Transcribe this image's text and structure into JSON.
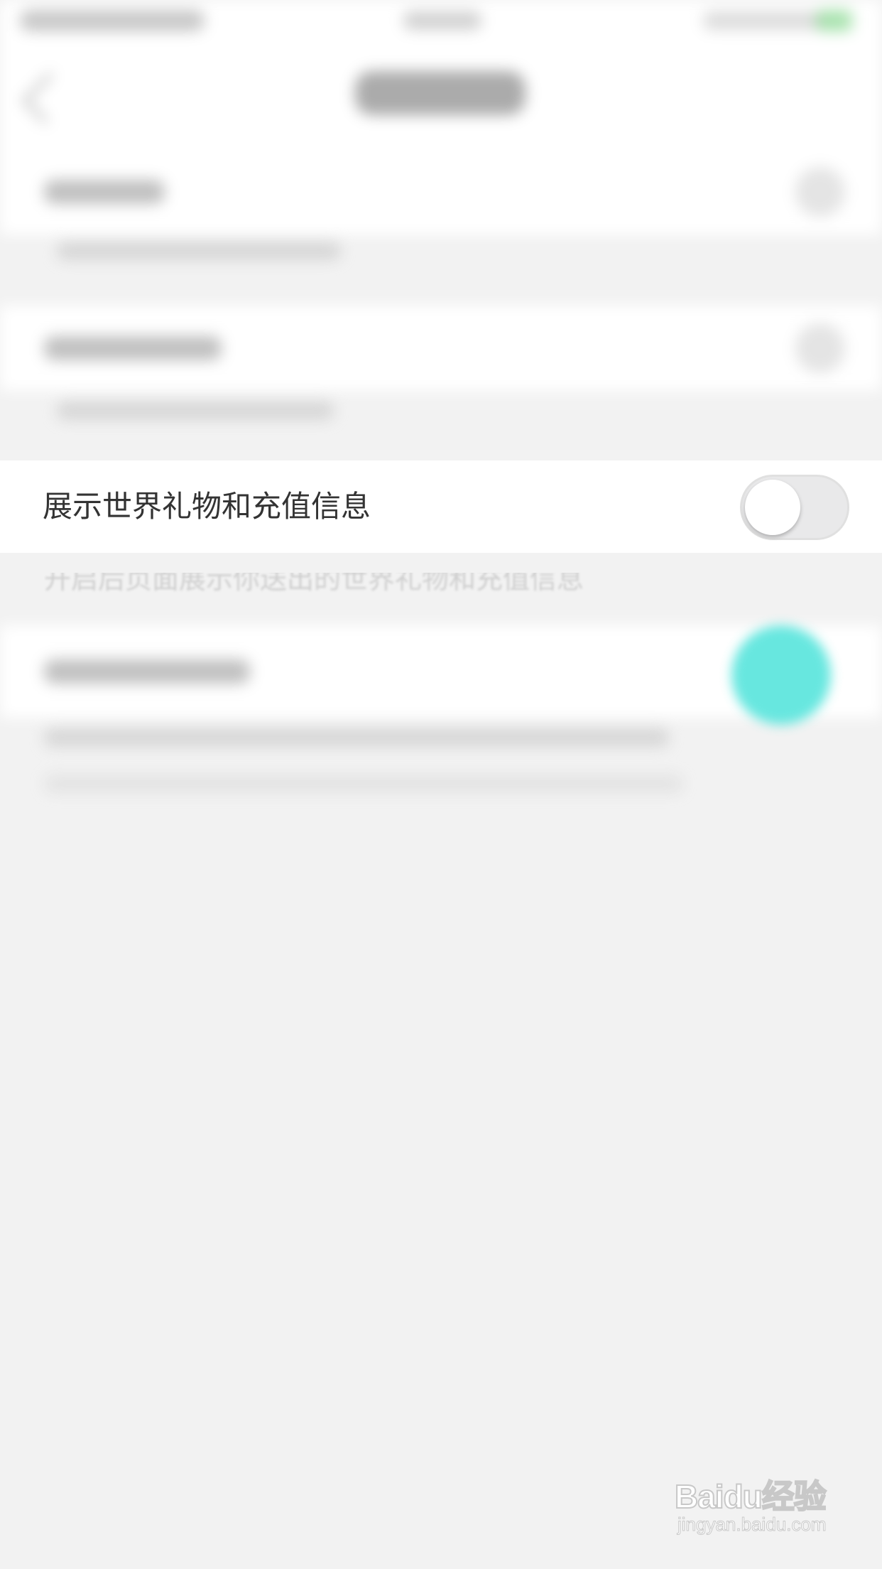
{
  "setting": {
    "label": "展示世界礼物和充值信息",
    "enabled": false,
    "description_partial": "开启后页面展示你送出的世界礼物和充值信息"
  },
  "colors": {
    "background": "#f2f2f2",
    "row_background": "#ffffff",
    "label_text": "#333333",
    "toggle_track_off": "#e9e9ea",
    "toggle_knob": "#ffffff",
    "accent_blob": "#4de3da"
  },
  "watermark": {
    "brand": "Baidu经验",
    "url": "jingyan.baidu.com"
  }
}
